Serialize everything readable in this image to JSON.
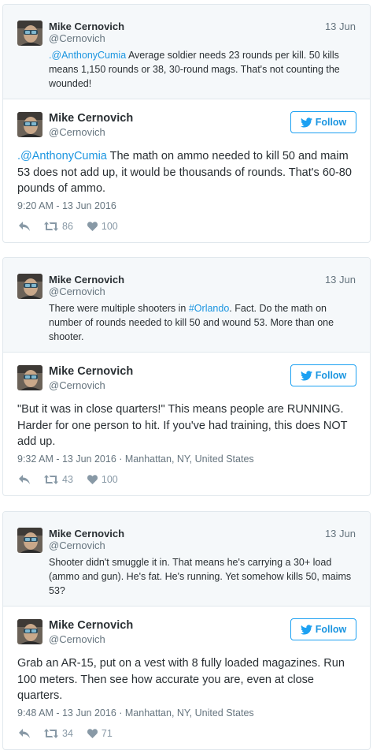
{
  "colors": {
    "link": "#1b95e0",
    "muted": "#66757f",
    "text": "#292f33",
    "quoted_bg": "#f5f8fa",
    "border": "#e1e8ed"
  },
  "cards": [
    {
      "quoted": {
        "name": "Mike Cernovich",
        "handle": "@Cernovich",
        "date": "13 Jun",
        "mention": ".@AnthonyCumia",
        "text": " Average soldier needs 23 rounds per kill. 50 kills means 1,150 rounds or 38, 30-round mags. That's not counting the wounded!"
      },
      "main": {
        "name": "Mike Cernovich",
        "handle": "@Cernovich",
        "follow_label": "Follow",
        "mention": ".@AnthonyCumia",
        "text": " The math on ammo needed to kill 50 and maim 53 does not add up, it would be thousands of rounds. That's 60-80 pounds of ammo.",
        "timestamp": "9:20 AM - 13 Jun 2016",
        "retweets": "86",
        "likes": "100"
      }
    },
    {
      "quoted": {
        "name": "Mike Cernovich",
        "handle": "@Cernovich",
        "date": "13 Jun",
        "text_before": "There were multiple shooters in ",
        "hashtag": "#Orlando",
        "text_after": ". Fact. Do the math on number of rounds needed to kill 50 and wound 53. More than one shooter."
      },
      "main": {
        "name": "Mike Cernovich",
        "handle": "@Cernovich",
        "follow_label": "Follow",
        "text": "\"But it was in close quarters!\" This means people are RUNNING. Harder for one person to hit. If you've had training, this does NOT add up.",
        "timestamp": "9:32 AM - 13 Jun 2016 · Manhattan, NY, United States",
        "retweets": "43",
        "likes": "100"
      }
    },
    {
      "quoted": {
        "name": "Mike Cernovich",
        "handle": "@Cernovich",
        "date": "13 Jun",
        "text": "Shooter didn't smuggle it in. That means he's carrying a 30+ load (ammo and gun). He's fat. He's running. Yet somehow kills 50, maims 53?"
      },
      "main": {
        "name": "Mike Cernovich",
        "handle": "@Cernovich",
        "follow_label": "Follow",
        "text": "Grab an AR-15, put on a vest with 8 fully loaded magazines. Run 100 meters. Then see how accurate you are, even at close quarters.",
        "timestamp": "9:48 AM - 13 Jun 2016 · Manhattan, NY, United States",
        "retweets": "34",
        "likes": "71"
      }
    }
  ]
}
